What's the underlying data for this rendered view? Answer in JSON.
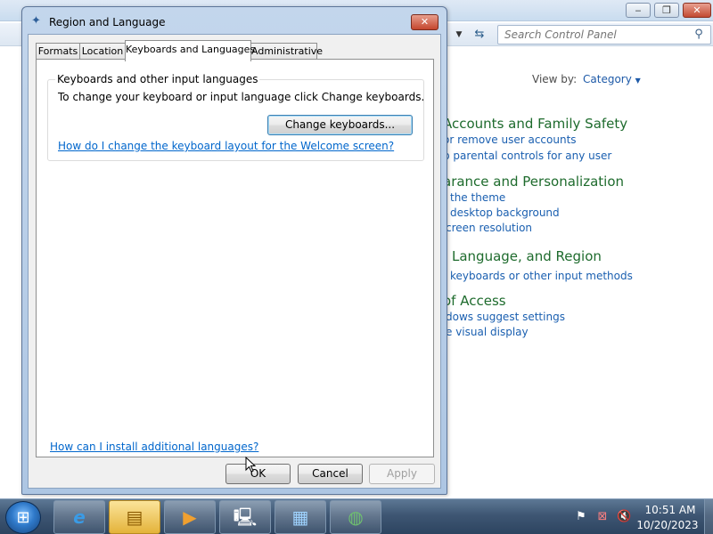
{
  "control_panel": {
    "search": {
      "placeholder": "Search Control Panel"
    },
    "view_by": {
      "label": "View by:",
      "value": "Category"
    },
    "categories": [
      {
        "heading": "Accounts and Family Safety",
        "links": [
          "or remove user accounts",
          "p parental controls for any user"
        ]
      },
      {
        "heading": "arance and Personalization",
        "links": [
          "the theme",
          "desktop background",
          "creen resolution"
        ]
      },
      {
        "heading": "Language, and Region",
        "links": [
          "keyboards or other input methods"
        ]
      },
      {
        "heading": "of Access",
        "links": [
          "dows suggest settings",
          "e visual display"
        ]
      }
    ]
  },
  "dialog": {
    "title": "Region and Language",
    "close_glyph": "✕",
    "tabs": [
      "Formats",
      "Location",
      "Keyboards and Languages",
      "Administrative"
    ],
    "active_tab": "Keyboards and Languages",
    "group": {
      "label": "Keyboards and other input languages",
      "description": "To change your keyboard or input language click Change keyboards.",
      "change_button": "Change keyboards...",
      "welcome_link": "How do I change the keyboard layout for the Welcome screen?"
    },
    "install_link": "How can I install additional languages?",
    "buttons": {
      "ok": "OK",
      "cancel": "Cancel",
      "apply": "Apply"
    }
  },
  "taskbar": {
    "pinned": [
      "internet-explorer",
      "windows-explorer",
      "media-player",
      "network-computer",
      "control-panel",
      "globe-app"
    ],
    "active": "windows-explorer",
    "clock": {
      "time": "10:51 AM",
      "date": "10/20/2023"
    }
  },
  "colors": {
    "category_heading": "#1e6b2d",
    "link": "#1a5fb0",
    "dialog_frame": "#adc6e3"
  }
}
